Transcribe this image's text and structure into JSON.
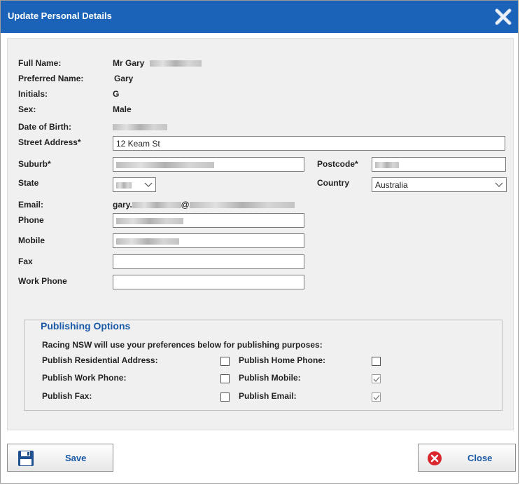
{
  "dialog": {
    "title": "Update Personal Details",
    "close_icon": "close-x-icon"
  },
  "details": {
    "full_name_label": "Full Name:",
    "full_name_value": "Mr Gary",
    "preferred_name_label": "Preferred Name:",
    "preferred_name_value": "Gary",
    "initials_label": "Initials:",
    "initials_value": "G",
    "sex_label": "Sex:",
    "sex_value": "Male",
    "dob_label": "Date of Birth:"
  },
  "form": {
    "street_label": "Street Address*",
    "street_value": "12 Keam St",
    "suburb_label": "Suburb*",
    "postcode_label": "Postcode*",
    "state_label": "State",
    "country_label": "Country",
    "country_value": "Australia",
    "email_label": "Email:",
    "email_prefix": "gary.",
    "email_at": "@",
    "phone_label": "Phone",
    "mobile_label": "Mobile",
    "fax_label": "Fax",
    "work_phone_label": "Work Phone"
  },
  "publishing": {
    "legend": "Publishing Options",
    "intro": "Racing NSW will use your preferences below for publishing purposes:",
    "options": [
      {
        "label": "Publish Residential Address:",
        "checked": false
      },
      {
        "label": "Publish Home Phone:",
        "checked": false
      },
      {
        "label": "Publish Work Phone:",
        "checked": false
      },
      {
        "label": "Publish Mobile:",
        "checked": true
      },
      {
        "label": "Publish Fax:",
        "checked": false
      },
      {
        "label": "Publish Email:",
        "checked": true
      }
    ]
  },
  "buttons": {
    "save_label": "Save",
    "save_icon": "floppy-disk-icon",
    "close_label": "Close",
    "close_icon": "red-x-circle-icon"
  },
  "colors": {
    "titlebar": "#1a63b8",
    "accent_text": "#1a5aa6",
    "close_red": "#d9262c"
  }
}
